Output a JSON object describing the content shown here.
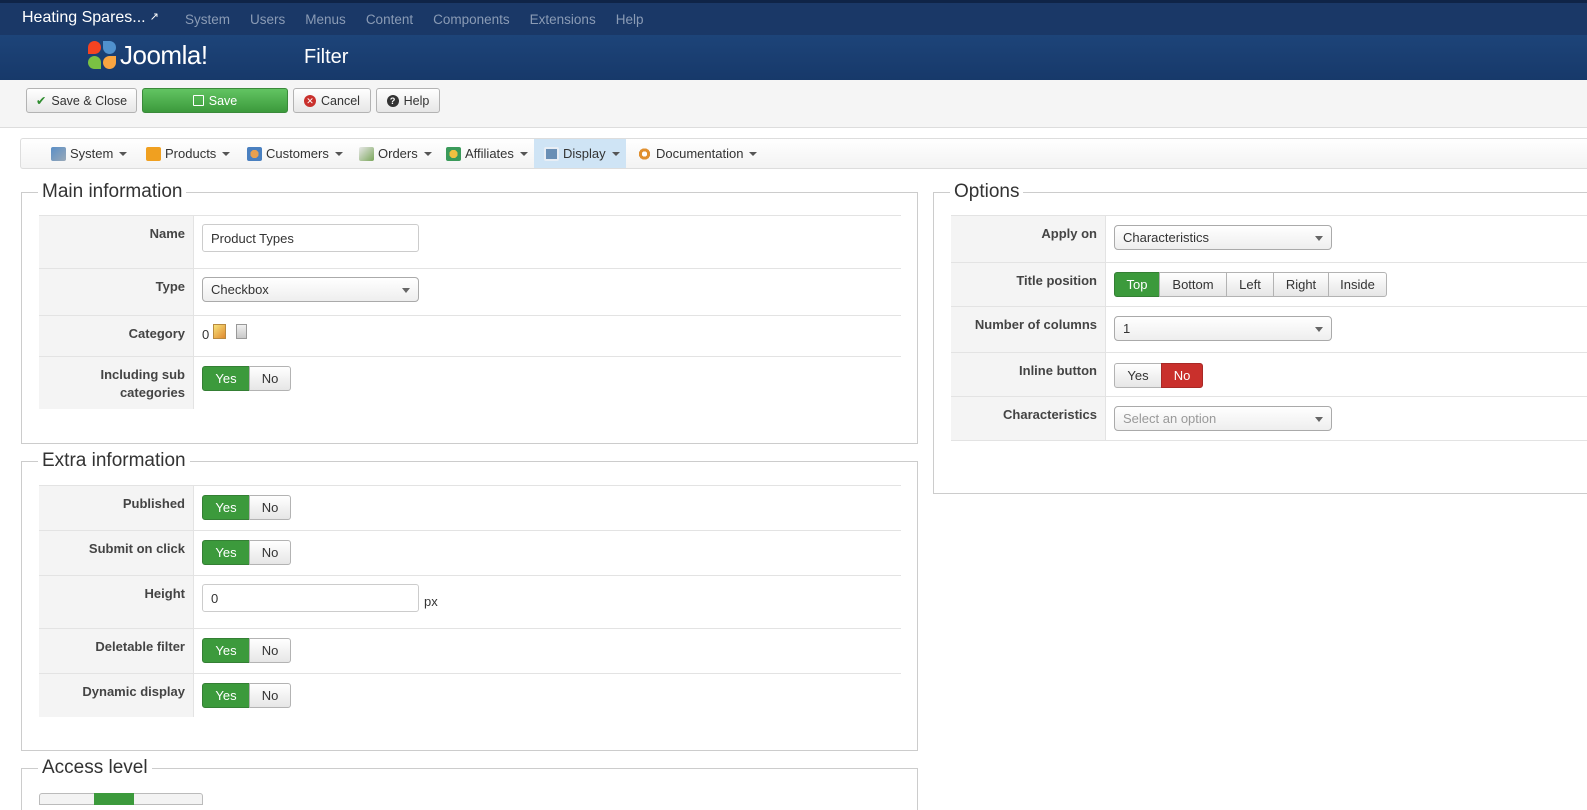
{
  "topbar": {
    "site_name": "Heating Spares...",
    "menu": [
      "System",
      "Users",
      "Menus",
      "Content",
      "Components",
      "Extensions",
      "Help"
    ]
  },
  "header": {
    "logo_text": "Joomla!",
    "title": "Filter"
  },
  "toolbar": {
    "save_close": "Save & Close",
    "save": "Save",
    "cancel": "Cancel",
    "help": "Help"
  },
  "component_menu": {
    "items": [
      "System",
      "Products",
      "Customers",
      "Orders",
      "Affiliates",
      "Display",
      "Documentation"
    ],
    "active": "Display"
  },
  "main_info": {
    "legend": "Main information",
    "name_label": "Name",
    "name_value": "Product Types",
    "type_label": "Type",
    "type_value": "Checkbox",
    "category_label": "Category",
    "category_value": "0",
    "subcat_label": "Including sub categories",
    "subcat_yes": "Yes",
    "subcat_no": "No",
    "subcat_selected": "Yes"
  },
  "extra_info": {
    "legend": "Extra information",
    "published_label": "Published",
    "submit_label": "Submit on click",
    "height_label": "Height",
    "height_value": "0",
    "height_unit": "px",
    "deletable_label": "Deletable filter",
    "dynamic_label": "Dynamic display",
    "yes": "Yes",
    "no": "No"
  },
  "access": {
    "legend": "Access level"
  },
  "options": {
    "legend": "Options",
    "apply_on_label": "Apply on",
    "apply_on_value": "Characteristics",
    "title_position_label": "Title position",
    "title_positions": [
      "Top",
      "Bottom",
      "Left",
      "Right",
      "Inside"
    ],
    "title_position_selected": "Top",
    "columns_label": "Number of columns",
    "columns_value": "1",
    "inline_label": "Inline button",
    "inline_yes": "Yes",
    "inline_no": "No",
    "inline_selected": "No",
    "characteristics_label": "Characteristics",
    "characteristics_placeholder": "Select an option"
  },
  "colors": {
    "navbar": "#1a3867",
    "header": "#1d4479",
    "green": "#3c9a3c",
    "red": "#c9302c",
    "active_menu": "#cfe4f5"
  }
}
